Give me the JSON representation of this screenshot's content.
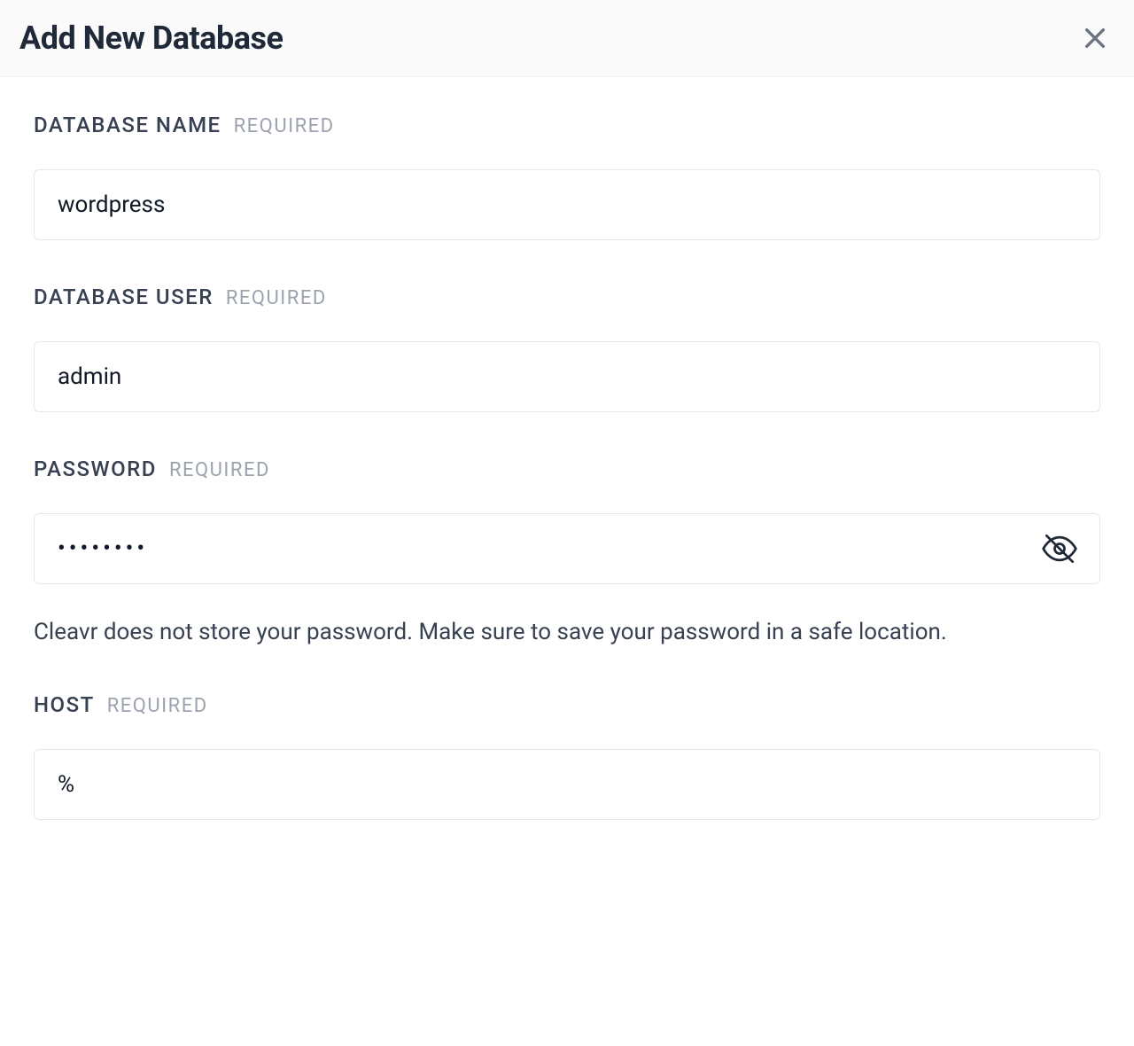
{
  "header": {
    "title": "Add New Database"
  },
  "form": {
    "required_label": "REQUIRED",
    "fields": {
      "database_name": {
        "label": "DATABASE NAME",
        "value": "wordpress"
      },
      "database_user": {
        "label": "DATABASE USER",
        "value": "admin"
      },
      "password": {
        "label": "PASSWORD",
        "value": "••••••••",
        "helper": "Cleavr does not store your password. Make sure to save your password in a safe location."
      },
      "host": {
        "label": "HOST",
        "value": "%"
      }
    }
  }
}
